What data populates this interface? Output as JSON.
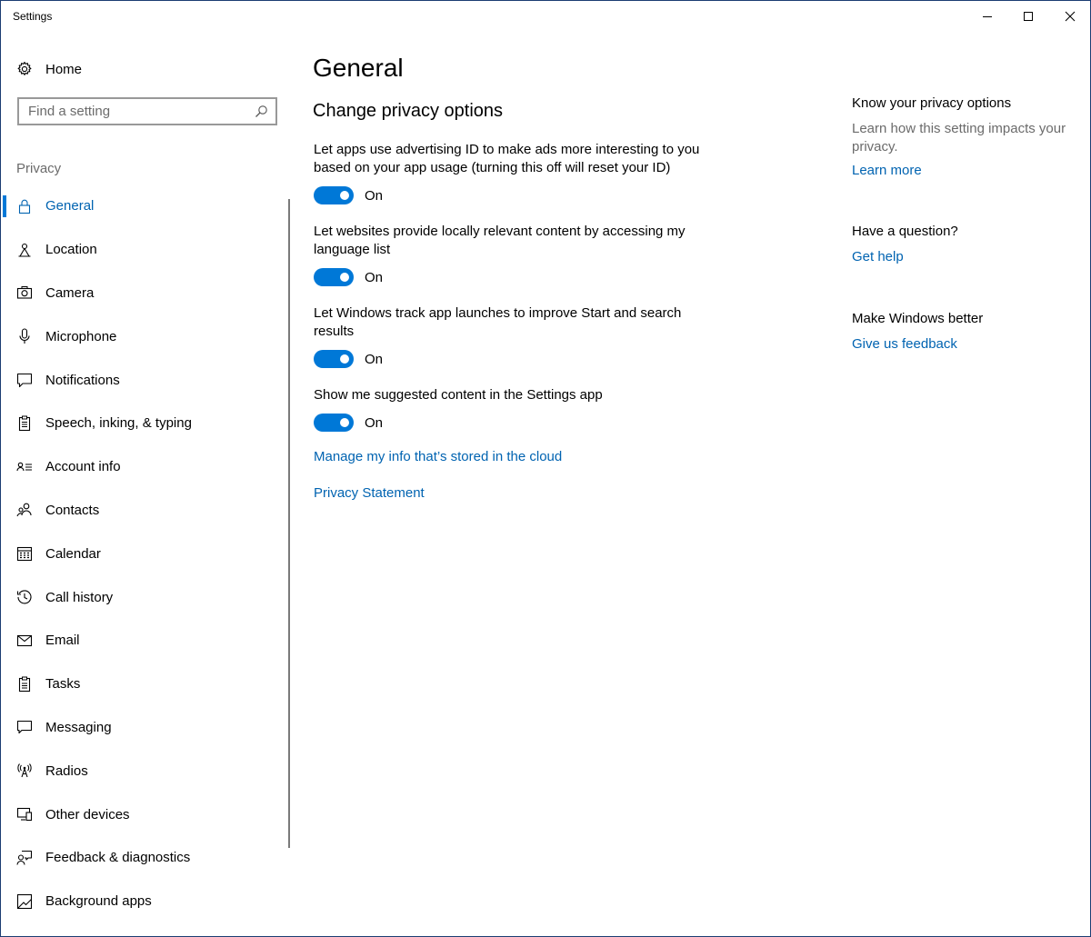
{
  "window": {
    "title": "Settings",
    "accent_color": "#0078d7",
    "link_color": "#0063b1"
  },
  "sidebar": {
    "home_label": "Home",
    "search_placeholder": "Find a setting",
    "section_title": "Privacy",
    "items": [
      {
        "label": "General",
        "icon": "lock-icon",
        "active": true
      },
      {
        "label": "Location",
        "icon": "location-icon"
      },
      {
        "label": "Camera",
        "icon": "camera-icon"
      },
      {
        "label": "Microphone",
        "icon": "microphone-icon"
      },
      {
        "label": "Notifications",
        "icon": "notifications-icon"
      },
      {
        "label": "Speech, inking, & typing",
        "icon": "speech-icon"
      },
      {
        "label": "Account info",
        "icon": "account-info-icon"
      },
      {
        "label": "Contacts",
        "icon": "contacts-icon"
      },
      {
        "label": "Calendar",
        "icon": "calendar-icon"
      },
      {
        "label": "Call history",
        "icon": "call-history-icon"
      },
      {
        "label": "Email",
        "icon": "email-icon"
      },
      {
        "label": "Tasks",
        "icon": "tasks-icon"
      },
      {
        "label": "Messaging",
        "icon": "messaging-icon"
      },
      {
        "label": "Radios",
        "icon": "radios-icon"
      },
      {
        "label": "Other devices",
        "icon": "other-devices-icon"
      },
      {
        "label": "Feedback & diagnostics",
        "icon": "feedback-icon"
      },
      {
        "label": "Background apps",
        "icon": "background-apps-icon"
      }
    ]
  },
  "main": {
    "title": "General",
    "section_heading": "Change privacy options",
    "settings": [
      {
        "description": "Let apps use advertising ID to make ads more interesting to you based on your app usage (turning this off will reset your ID)",
        "state": "On"
      },
      {
        "description": "Let websites provide locally relevant content by accessing my language list",
        "state": "On"
      },
      {
        "description": "Let Windows track app launches to improve Start and search results",
        "state": "On"
      },
      {
        "description": "Show me suggested content in the Settings app",
        "state": "On"
      }
    ],
    "links": {
      "manage_info": "Manage my info that’s stored in the cloud",
      "privacy_statement": "Privacy Statement"
    }
  },
  "aside": {
    "know_heading": "Know your privacy options",
    "know_text": "Learn how this setting impacts your privacy.",
    "learn_more": "Learn more",
    "question_heading": "Have a question?",
    "get_help": "Get help",
    "better_heading": "Make Windows better",
    "feedback_link": "Give us feedback"
  }
}
